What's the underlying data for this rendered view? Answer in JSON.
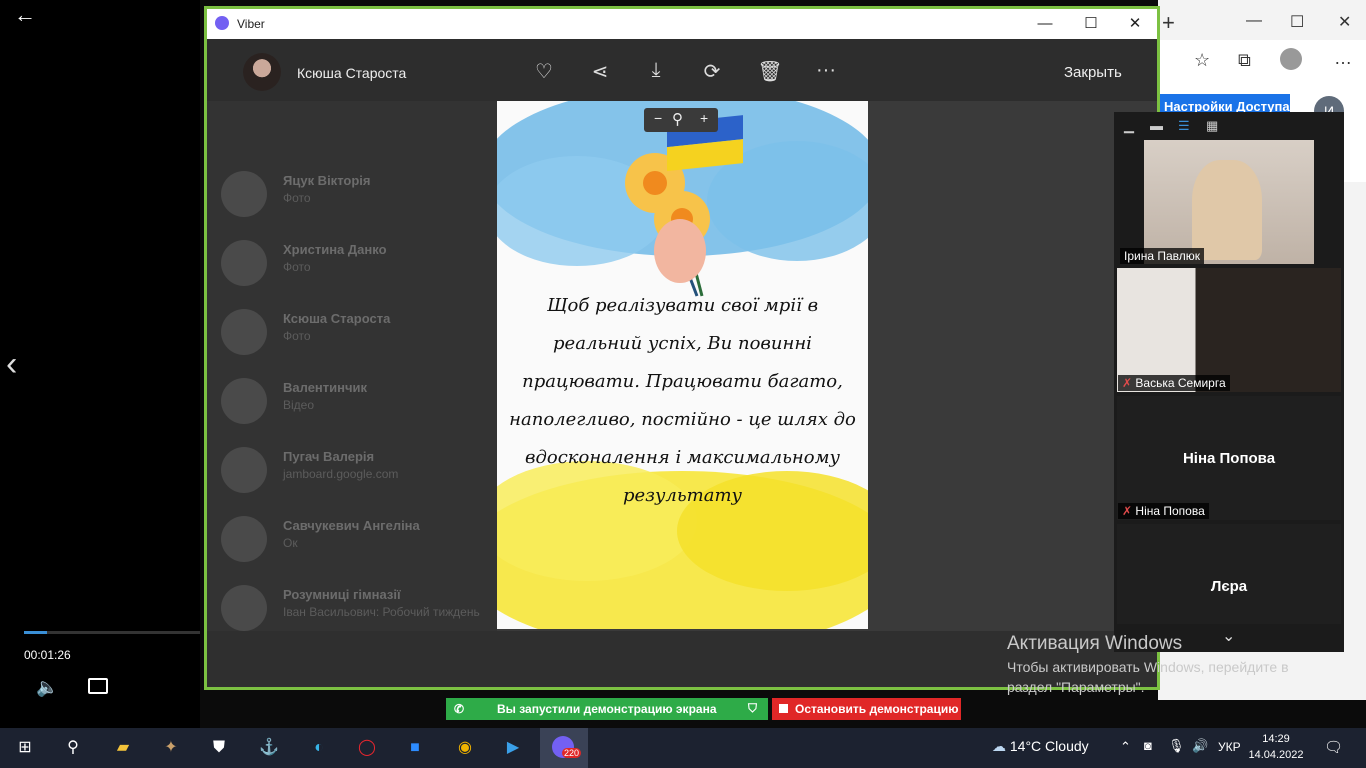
{
  "player": {
    "timecode": "00:01:26",
    "progress_percent": 13,
    "icons": {
      "back": "back-arrow-icon",
      "prev": "chevron-left-icon",
      "volume": "volume-icon",
      "subtitles": "subtitles-icon"
    }
  },
  "browser": {
    "access_button": "Настройки Доступа",
    "avatar_initial": "И"
  },
  "viber": {
    "window_title": "Viber",
    "sender_name": "Ксюша Староста",
    "close_label": "Закрыть",
    "chats": [
      {
        "name": "Яцук Вікторія",
        "sub": "Фото"
      },
      {
        "name": "Христина Данко",
        "sub": "Фото"
      },
      {
        "name": "Ксюша Староста",
        "sub": "Фото"
      },
      {
        "name": "Валентинчик",
        "sub": "Відео"
      },
      {
        "name": "Пугач Валерія",
        "sub": "jamboard.google.com"
      },
      {
        "name": "Савчукевич Ангеліна",
        "sub": "Ок"
      },
      {
        "name": "Розумниці гімназії",
        "sub": "Іван Васильович: Робочий тиждень"
      }
    ],
    "poster": {
      "quote": "Щоб реалізувати свої мрії в реальний успіх, Ви повинні працювати. Працювати багато, наполегливо, постійно - це шлях до вдосконалення і максимальному результату"
    }
  },
  "call": {
    "participants": [
      {
        "name": "Ірина Павлюк",
        "muted": false
      },
      {
        "name": "Васька Семирга",
        "muted": true
      },
      {
        "name": "Ніна Попова",
        "muted": true
      },
      {
        "name": "Лєра",
        "muted": false
      }
    ]
  },
  "watermark": {
    "title": "Активация Windows",
    "subtitle": "Чтобы активировать Windows, перейдите в раздел \"Параметры\"."
  },
  "share_bar": {
    "status": "Вы запустили демонстрацию экрана",
    "stop": "Остановить демонстрацию"
  },
  "taskbar": {
    "weather": "14°C  Cloudy",
    "language": "УКР",
    "time": "14:29",
    "date": "14.04.2022",
    "viber_badge": "220"
  }
}
